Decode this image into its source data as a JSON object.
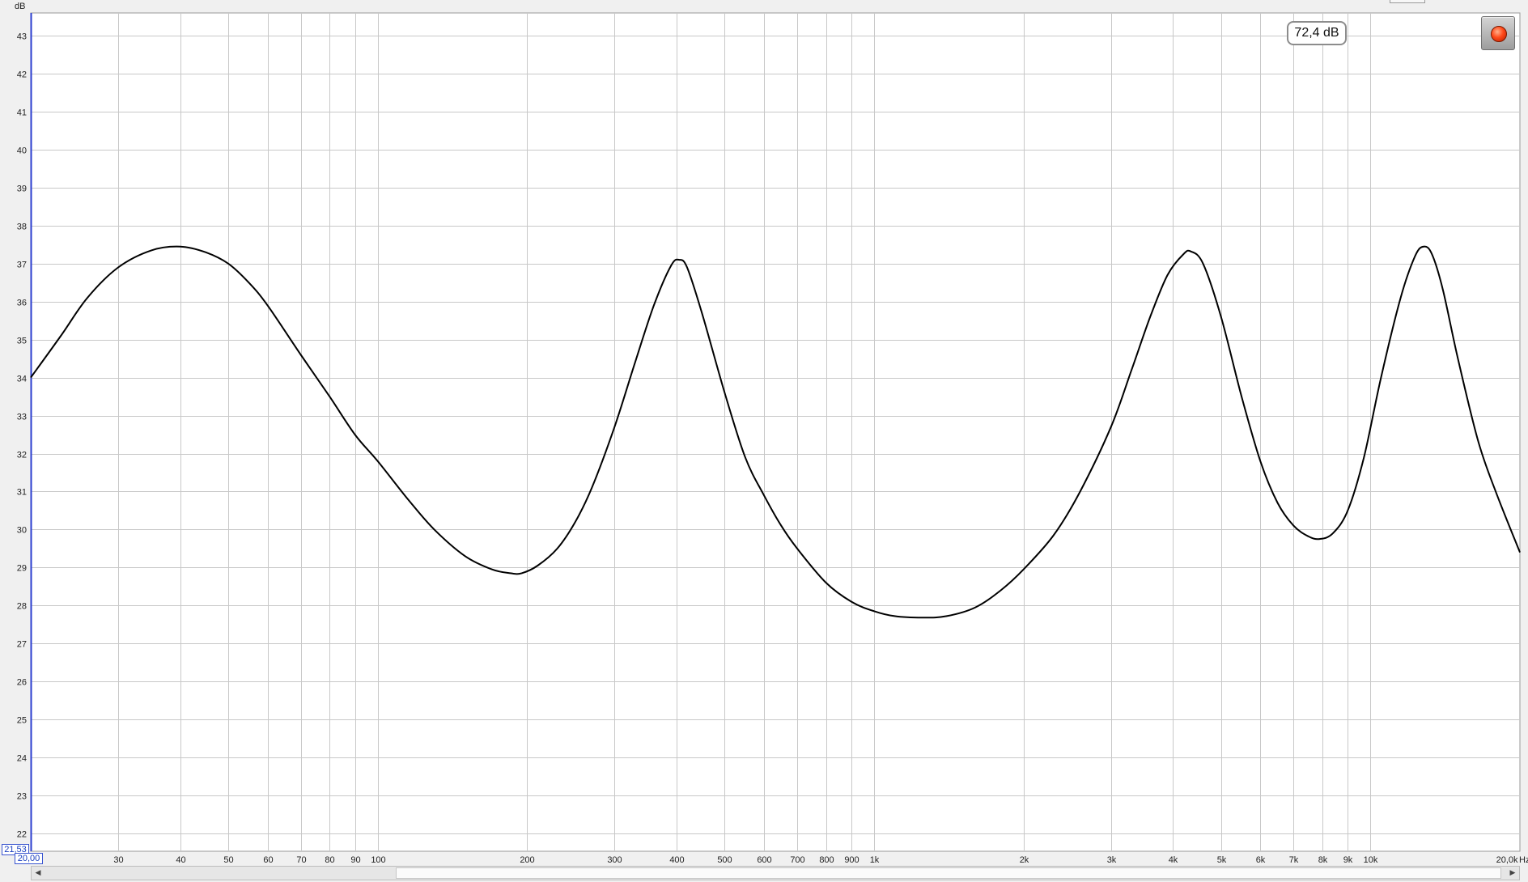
{
  "chart_data": {
    "type": "line",
    "title": "",
    "ylabel": "dB",
    "xlabel": "Hz",
    "x_scale": "log",
    "xlim": [
      20,
      20000
    ],
    "ylim": [
      21.53,
      43.6
    ],
    "grid": true,
    "y_ticks": [
      "22",
      "23",
      "24",
      "25",
      "26",
      "27",
      "28",
      "29",
      "30",
      "31",
      "32",
      "33",
      "34",
      "35",
      "36",
      "37",
      "38",
      "39",
      "40",
      "41",
      "42",
      "43"
    ],
    "x_ticks": [
      {
        "v": 30,
        "label": "30"
      },
      {
        "v": 40,
        "label": "40"
      },
      {
        "v": 50,
        "label": "50"
      },
      {
        "v": 60,
        "label": "60"
      },
      {
        "v": 70,
        "label": "70"
      },
      {
        "v": 80,
        "label": "80"
      },
      {
        "v": 90,
        "label": "90"
      },
      {
        "v": 100,
        "label": "100"
      },
      {
        "v": 200,
        "label": "200"
      },
      {
        "v": 300,
        "label": "300"
      },
      {
        "v": 400,
        "label": "400"
      },
      {
        "v": 500,
        "label": "500"
      },
      {
        "v": 600,
        "label": "600"
      },
      {
        "v": 700,
        "label": "700"
      },
      {
        "v": 800,
        "label": "800"
      },
      {
        "v": 900,
        "label": "900"
      },
      {
        "v": 1000,
        "label": "1k"
      },
      {
        "v": 2000,
        "label": "2k"
      },
      {
        "v": 3000,
        "label": "3k"
      },
      {
        "v": 4000,
        "label": "4k"
      },
      {
        "v": 5000,
        "label": "5k"
      },
      {
        "v": 6000,
        "label": "6k"
      },
      {
        "v": 7000,
        "label": "7k"
      },
      {
        "v": 8000,
        "label": "8k"
      },
      {
        "v": 9000,
        "label": "9k"
      },
      {
        "v": 10000,
        "label": "10k"
      },
      {
        "v": 20000,
        "label": "20,0k"
      }
    ],
    "series": [
      {
        "color": "#000000",
        "points": [
          [
            20,
            34.0
          ],
          [
            23,
            35.1
          ],
          [
            26,
            36.1
          ],
          [
            30,
            36.9
          ],
          [
            35,
            37.35
          ],
          [
            40,
            37.45
          ],
          [
            45,
            37.3
          ],
          [
            50,
            37.0
          ],
          [
            55,
            36.5
          ],
          [
            60,
            35.9
          ],
          [
            70,
            34.6
          ],
          [
            80,
            33.5
          ],
          [
            90,
            32.5
          ],
          [
            100,
            31.8
          ],
          [
            115,
            30.8
          ],
          [
            130,
            30.0
          ],
          [
            150,
            29.3
          ],
          [
            170,
            28.95
          ],
          [
            185,
            28.85
          ],
          [
            195,
            28.85
          ],
          [
            210,
            29.05
          ],
          [
            230,
            29.5
          ],
          [
            250,
            30.2
          ],
          [
            270,
            31.1
          ],
          [
            300,
            32.7
          ],
          [
            330,
            34.4
          ],
          [
            360,
            35.9
          ],
          [
            390,
            36.95
          ],
          [
            405,
            37.1
          ],
          [
            420,
            36.9
          ],
          [
            450,
            35.7
          ],
          [
            500,
            33.6
          ],
          [
            550,
            31.9
          ],
          [
            600,
            30.9
          ],
          [
            650,
            30.1
          ],
          [
            700,
            29.5
          ],
          [
            800,
            28.6
          ],
          [
            900,
            28.1
          ],
          [
            1000,
            27.85
          ],
          [
            1100,
            27.72
          ],
          [
            1250,
            27.68
          ],
          [
            1400,
            27.72
          ],
          [
            1600,
            27.95
          ],
          [
            1800,
            28.4
          ],
          [
            2000,
            28.95
          ],
          [
            2300,
            29.85
          ],
          [
            2600,
            31.0
          ],
          [
            3000,
            32.7
          ],
          [
            3300,
            34.2
          ],
          [
            3600,
            35.6
          ],
          [
            3900,
            36.7
          ],
          [
            4200,
            37.25
          ],
          [
            4350,
            37.32
          ],
          [
            4600,
            37.0
          ],
          [
            5000,
            35.6
          ],
          [
            5500,
            33.5
          ],
          [
            6000,
            31.8
          ],
          [
            6500,
            30.7
          ],
          [
            7000,
            30.1
          ],
          [
            7500,
            29.82
          ],
          [
            7900,
            29.75
          ],
          [
            8400,
            29.9
          ],
          [
            9000,
            30.5
          ],
          [
            9700,
            31.9
          ],
          [
            10500,
            34.0
          ],
          [
            11500,
            36.1
          ],
          [
            12300,
            37.2
          ],
          [
            12800,
            37.45
          ],
          [
            13300,
            37.25
          ],
          [
            14000,
            36.3
          ],
          [
            15000,
            34.5
          ],
          [
            16500,
            32.3
          ],
          [
            18000,
            30.9
          ],
          [
            20000,
            29.4
          ]
        ]
      }
    ]
  },
  "overlay": {
    "level_readout": "72,4 dB",
    "y_min_value": "21,53",
    "x_min_value": "20,00"
  },
  "icons": {
    "record": "record-icon",
    "scroll_left": "arrow-left-icon",
    "scroll_right": "arrow-right-icon"
  }
}
